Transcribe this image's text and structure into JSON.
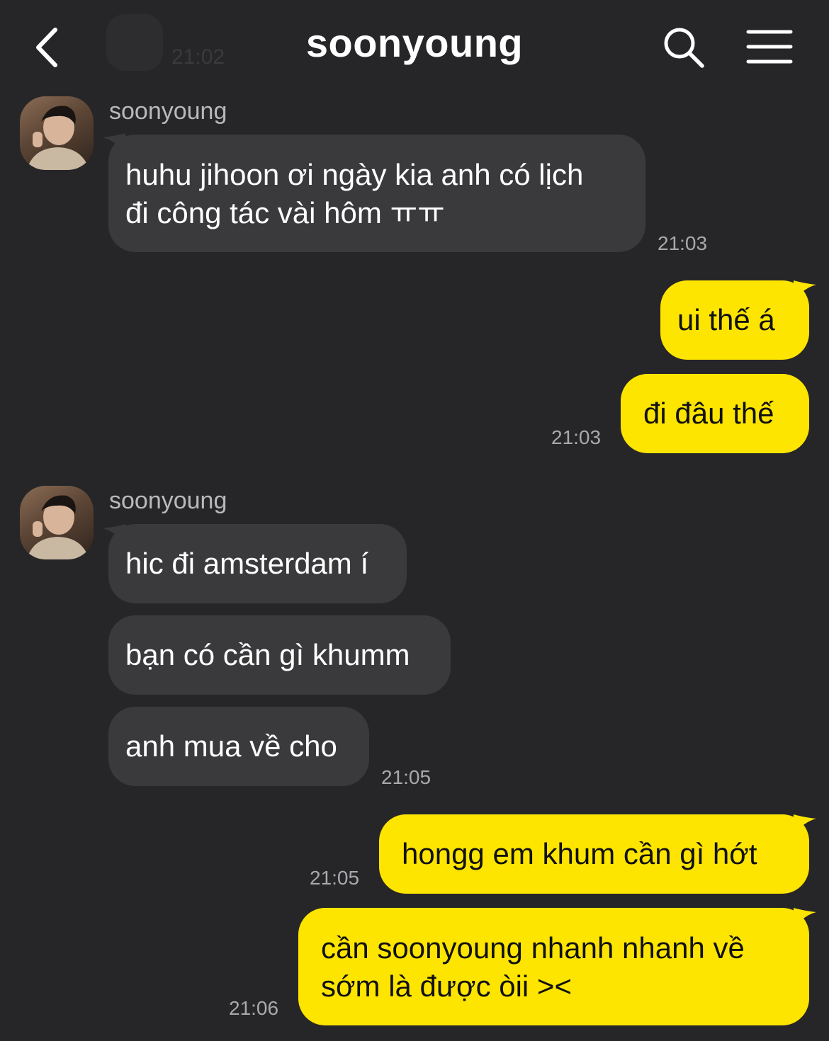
{
  "header": {
    "title": "soonyoung",
    "ghost_time": "21:02",
    "back_icon": "chevron-left-icon",
    "search_icon": "search-icon",
    "menu_icon": "hamburger-menu-icon"
  },
  "colors": {
    "background": "#262628",
    "incoming_bubble": "#3a3a3c",
    "outgoing_bubble": "#fee500",
    "timestamp": "#a9a9ad"
  },
  "groups": [
    {
      "direction": "in",
      "sender": "soonyoung",
      "messages": [
        {
          "lines": [
            "huhu jihoon ơi ngày kia anh có lịch",
            "đi công tác vài hôm ㅠㅠ"
          ]
        }
      ],
      "time": "21:03"
    },
    {
      "direction": "out",
      "messages": [
        {
          "lines": [
            "ui thế á"
          ]
        },
        {
          "lines": [
            "đi đâu thế"
          ]
        }
      ],
      "time": "21:03"
    },
    {
      "direction": "in",
      "sender": "soonyoung",
      "messages": [
        {
          "lines": [
            "hic đi amsterdam í"
          ]
        },
        {
          "lines": [
            "bạn có cần gì khumm"
          ]
        },
        {
          "lines": [
            "anh mua về cho"
          ]
        }
      ],
      "time": "21:05"
    },
    {
      "direction": "out",
      "messages": [
        {
          "lines": [
            "hongg em khum cần gì hớt"
          ]
        }
      ],
      "time": "21:05"
    },
    {
      "direction": "out",
      "messages": [
        {
          "lines": [
            "cần soonyoung nhanh nhanh về",
            "sớm là được òii ><"
          ]
        }
      ],
      "time": "21:06"
    }
  ]
}
